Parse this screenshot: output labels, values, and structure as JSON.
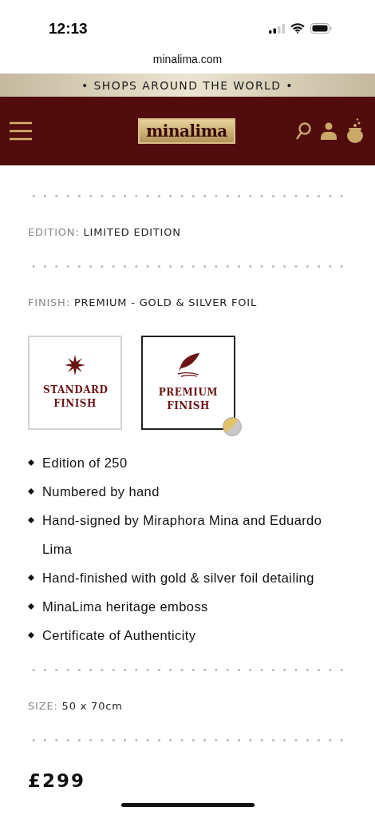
{
  "status_bar": {
    "time": "12:13"
  },
  "browser": {
    "url": "minalima.com"
  },
  "banner": {
    "text": "• SHOPS AROUND THE WORLD •"
  },
  "header": {
    "logo": "minalima"
  },
  "edition": {
    "label": "EDITION:",
    "value": "LIMITED EDITION"
  },
  "finish": {
    "label": "FINISH:",
    "value": "PREMIUM - GOLD & SILVER FOIL"
  },
  "finish_options": [
    {
      "kind": "star",
      "label": "STANDARD FINISH",
      "selected": false
    },
    {
      "kind": "quill",
      "label": "PREMIUM FINISH",
      "selected": true
    }
  ],
  "features": [
    "Edition of 250",
    "Numbered by hand",
    "Hand-signed by Miraphora Mina and Eduardo Lima",
    "Hand-finished with gold & silver foil detailing",
    "MinaLima heritage emboss",
    "Certificate of Authenticity"
  ],
  "size": {
    "label": "SIZE:",
    "value": "50 x 70cm"
  },
  "price": "£299"
}
